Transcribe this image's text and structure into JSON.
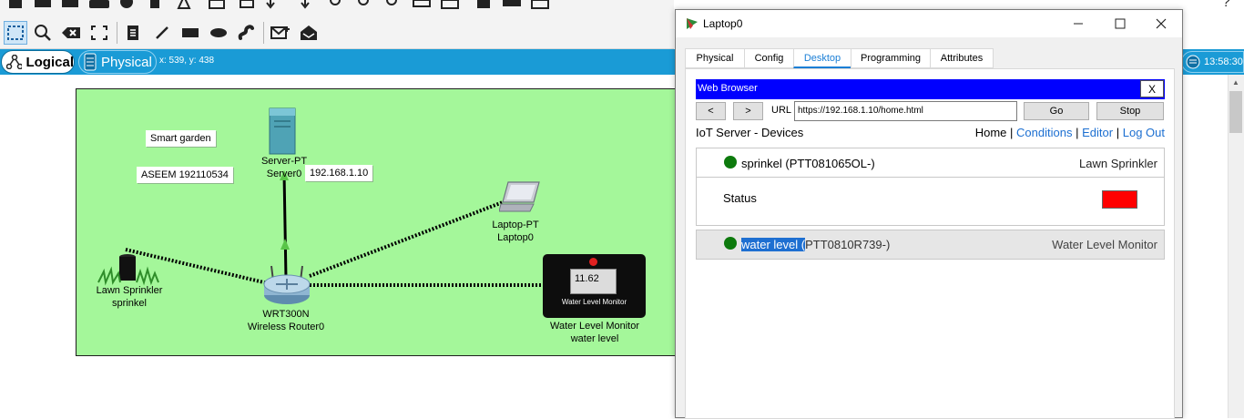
{
  "toolbar_top": {
    "icons": [
      "folder-icon",
      "save-icon",
      "save-as-icon",
      "print-icon",
      "info-icon",
      "wizard-icon",
      "copy-icon",
      "paste-icon",
      "undo-icon",
      "redo-icon",
      "zoom-in-icon",
      "zoom-reset-icon",
      "zoom-out-icon",
      "draw-palette-icon",
      "custom-device-icon",
      "viewport-icon",
      "screenshot-icon"
    ]
  },
  "toolbar_edit": {
    "icons": [
      "select-icon",
      "inspect-icon",
      "delete-icon",
      "resize-icon",
      "note-icon",
      "line-icon",
      "rectangle-icon",
      "ellipse-icon",
      "freeform-icon",
      "add-pdu-icon",
      "add-complex-pdu-icon"
    ]
  },
  "mode_bar": {
    "logical_label": "Logical",
    "physical_label": "Physical",
    "coords": "x: 539, y: 438",
    "clock": "13:58:30"
  },
  "canvas": {
    "notes": [
      "Smart garden",
      "ASEEM 192110534",
      "192.168.1.10"
    ],
    "devices": {
      "server": {
        "model": "Server-PT",
        "name": "Server0"
      },
      "laptop": {
        "model": "Laptop-PT",
        "name": "Laptop0"
      },
      "sprinkler": {
        "model": "Lawn Sprinkler",
        "name": "sprinkel"
      },
      "router": {
        "model": "WRT300N",
        "name": "Wireless Router0"
      },
      "monitor": {
        "model": "Water Level Monitor",
        "name": "water level",
        "reading": "11.62",
        "screen_label": "Water Level Monitor"
      }
    },
    "colors": {
      "garden": "#a4f79a",
      "link": "#000000",
      "link_arrow": "#59c548"
    }
  },
  "window": {
    "title": "Laptop0",
    "tabs": [
      "Physical",
      "Config",
      "Desktop",
      "Programming",
      "Attributes"
    ],
    "active_tab": "Desktop",
    "browser": {
      "title": "Web Browser",
      "close_label": "X",
      "back_label": "<",
      "forward_label": ">",
      "url_label": "URL",
      "url_value": "https://192.168.1.10/home.html",
      "go_label": "Go",
      "stop_label": "Stop",
      "page": {
        "heading": "IoT Server - Devices",
        "nav": [
          "Home",
          "Conditions",
          "Editor",
          "Log Out"
        ],
        "nav_sep": "|",
        "devices": [
          {
            "name": "sprinkel",
            "id": "(PTT081065OL-)",
            "type": "Lawn Sprinkler",
            "status_label": "Status",
            "status_color": "#ff0000",
            "online_color": "#0d7a0d"
          },
          {
            "name_selected": "water level (",
            "id_rest": "PTT0810R739-)",
            "type": "Water Level Monitor",
            "online_color": "#0d7a0d"
          }
        ]
      }
    }
  }
}
